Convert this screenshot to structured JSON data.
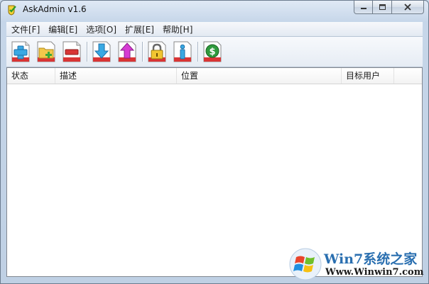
{
  "window": {
    "title": "AskAdmin v1.6"
  },
  "menu": [
    {
      "label": "文件[F]"
    },
    {
      "label": "编辑[E]"
    },
    {
      "label": "选项[O]"
    },
    {
      "label": "扩展[E]"
    },
    {
      "label": "帮助[H]"
    }
  ],
  "toolbar": {
    "icons": [
      "add-icon",
      "add-folder-icon",
      "remove-icon",
      "download-icon",
      "upload-icon",
      "lock-icon",
      "info-icon",
      "dollar-icon"
    ]
  },
  "list": {
    "columns": [
      {
        "label": "状态"
      },
      {
        "label": "描述"
      },
      {
        "label": "位置"
      },
      {
        "label": "目标用户"
      }
    ],
    "rows": []
  },
  "watermark": {
    "site": "Win7系统之家",
    "url": "Www.Winwin7.com"
  },
  "colors": {
    "accent": "#2a6fb0",
    "close_red": "#c75050"
  }
}
